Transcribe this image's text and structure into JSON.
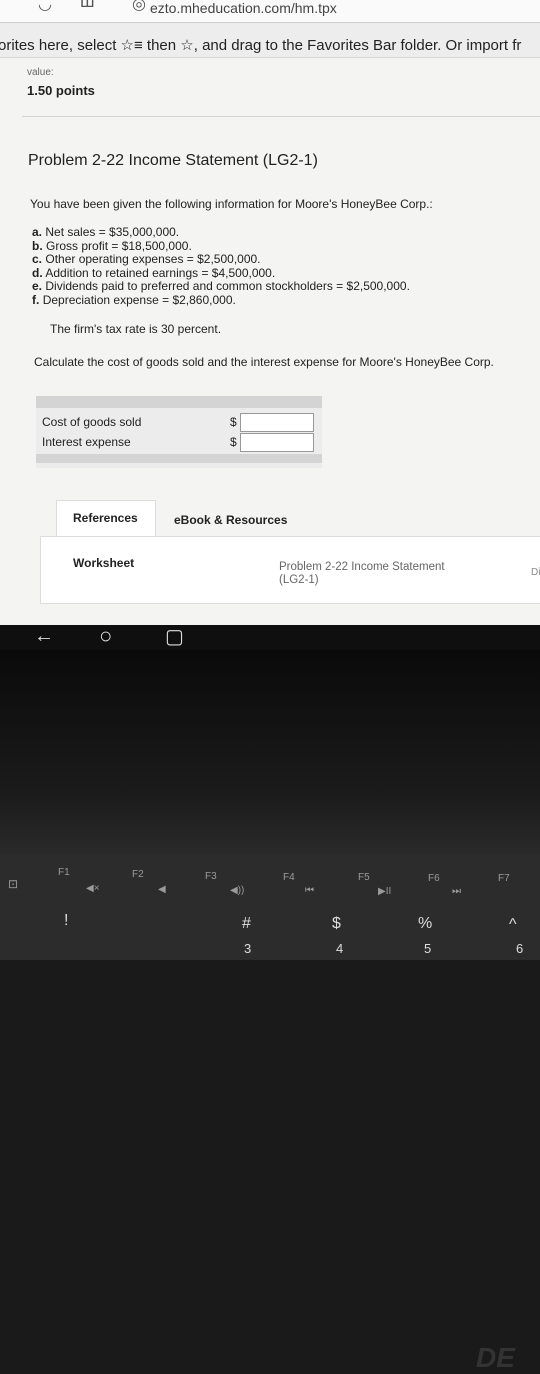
{
  "browser": {
    "url": "ezto.mheducation.com/hm.tpx",
    "favorites_prompt": "orites here, select ☆≡ then ☆, and drag to the Favorites Bar folder. Or import fr"
  },
  "question": {
    "value_label": "value:",
    "points": "1.50 points",
    "title": "Problem 2-22 Income Statement (LG2-1)",
    "intro": "You have been given the following information for Moore's HoneyBee Corp.:",
    "items": [
      {
        "letter": "a.",
        "text": "Net sales = $35,000,000."
      },
      {
        "letter": "b.",
        "text": "Gross profit = $18,500,000."
      },
      {
        "letter": "c.",
        "text": "Other operating expenses = $2,500,000."
      },
      {
        "letter": "d.",
        "text": "Addition to retained earnings = $4,500,000."
      },
      {
        "letter": "e.",
        "text": "Dividends paid to preferred and common stockholders = $2,500,000."
      },
      {
        "letter": "f.",
        "text": "Depreciation expense = $2,860,000."
      }
    ],
    "tax_rate": "The firm's tax rate is 30 percent.",
    "prompt": "Calculate the cost of goods sold and the interest expense for Moore's HoneyBee Corp.",
    "answers": [
      {
        "label": "Cost of goods sold",
        "currency": "$",
        "value": ""
      },
      {
        "label": "Interest expense",
        "currency": "$",
        "value": ""
      }
    ]
  },
  "tabs": {
    "references": "References",
    "ebook": "eBook & Resources"
  },
  "panel": {
    "worksheet": "Worksheet",
    "link_line1": "Problem 2-22 Income Statement",
    "link_line2": "(LG2-1)",
    "edge_text": "Di"
  },
  "nav": {
    "back": "←",
    "home": "○",
    "recents": "▢"
  },
  "hardware": {
    "logo": "DE",
    "fkeys": [
      "F1",
      "F2",
      "F3",
      "F4",
      "F5",
      "F6",
      "F7"
    ],
    "media": [
      "◀×",
      "◀",
      "◀))",
      "⏮",
      "▶II",
      "⏭"
    ],
    "numrow": [
      "!",
      "#",
      "$",
      "%",
      "^"
    ],
    "numrow_digits": [
      "3",
      "4",
      "5",
      "6"
    ]
  }
}
